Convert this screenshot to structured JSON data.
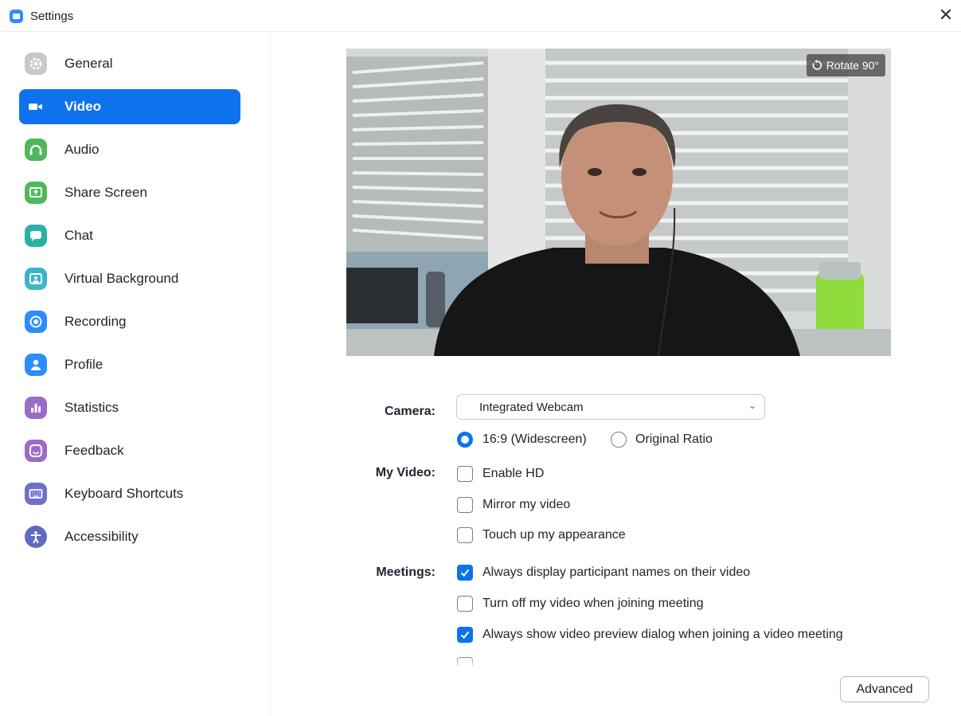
{
  "window": {
    "title": "Settings",
    "close_glyph": "✕",
    "accent": "#0e72ed"
  },
  "sidebar": {
    "items": [
      {
        "label": "General",
        "icon": "gear-icon",
        "color": "#c8c8cc",
        "active": false
      },
      {
        "label": "Video",
        "icon": "video-camera-icon",
        "color": "#0e72ed",
        "active": true
      },
      {
        "label": "Audio",
        "icon": "headphones-icon",
        "color": "#4fb85b",
        "active": false
      },
      {
        "label": "Share Screen",
        "icon": "share-screen-icon",
        "color": "#4fb85b",
        "active": false
      },
      {
        "label": "Chat",
        "icon": "chat-bubble-icon",
        "color": "#2bb0a6",
        "active": false
      },
      {
        "label": "Virtual Background",
        "icon": "virtual-background-icon",
        "color": "#3bb5c9",
        "active": false
      },
      {
        "label": "Recording",
        "icon": "record-icon",
        "color": "#2d8cff",
        "active": false
      },
      {
        "label": "Profile",
        "icon": "user-icon",
        "color": "#2d8cff",
        "active": false
      },
      {
        "label": "Statistics",
        "icon": "bar-chart-icon",
        "color": "#9c6bc7",
        "active": false
      },
      {
        "label": "Feedback",
        "icon": "smiley-icon",
        "color": "#9c6bc7",
        "active": false
      },
      {
        "label": "Keyboard Shortcuts",
        "icon": "keyboard-icon",
        "color": "#6f6fc8",
        "active": false
      },
      {
        "label": "Accessibility",
        "icon": "accessibility-icon",
        "color": "#5f6bc0",
        "active": false
      }
    ]
  },
  "preview": {
    "rotate_label": "Rotate 90°"
  },
  "camera": {
    "label": "Camera:",
    "selected": "Integrated Webcam",
    "ratio_options": [
      {
        "label": "16:9 (Widescreen)",
        "selected": true
      },
      {
        "label": "Original Ratio",
        "selected": false
      }
    ]
  },
  "my_video": {
    "label": "My Video:",
    "options": [
      {
        "label": "Enable HD",
        "checked": false
      },
      {
        "label": "Mirror my video",
        "checked": false
      },
      {
        "label": "Touch up my appearance",
        "checked": false
      }
    ]
  },
  "meetings": {
    "label": "Meetings:",
    "options": [
      {
        "label": "Always display participant names on their video",
        "checked": true
      },
      {
        "label": "Turn off my video when joining meeting",
        "checked": false
      },
      {
        "label": "Always show video preview dialog when joining a video meeting",
        "checked": true
      }
    ]
  },
  "advanced_button": "Advanced"
}
